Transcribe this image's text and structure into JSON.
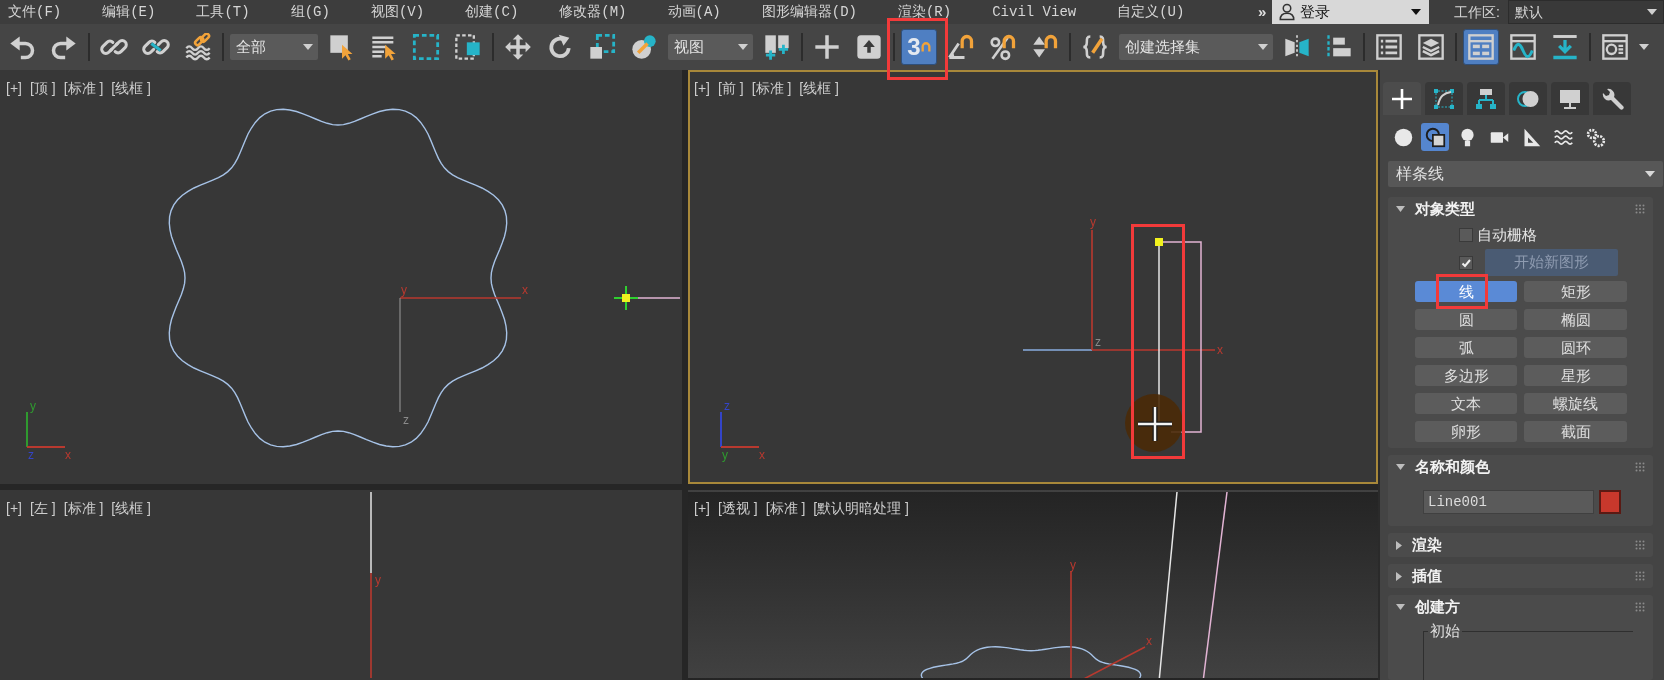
{
  "menu_bar": {
    "items": [
      "文件(F)",
      "编辑(E)",
      "工具(T)",
      "组(G)",
      "视图(V)",
      "创建(C)",
      "修改器(M)",
      "动画(A)",
      "图形编辑器(D)",
      "渲染(R)",
      "Civil View",
      "自定义(U)"
    ],
    "overflow": "»",
    "login": "登录",
    "workspace_label": "工作区:",
    "workspace": "默认"
  },
  "toolbar": {
    "selection_filter": "全部",
    "reference_coordinate": "视图",
    "snap_toggle": {
      "label": "3",
      "on": true
    },
    "named_selection_set": "创建选择集",
    "ribbon_toggle": {
      "on": true
    }
  },
  "viewports": [
    {
      "kind": "top",
      "selected": false,
      "labels": [
        "[+]",
        "[顶 ]",
        "[标准 ]",
        "[线框 ]"
      ],
      "axis_labels": [
        "y",
        "x",
        "z"
      ],
      "tripod_labels": [
        "y",
        "z",
        "x"
      ]
    },
    {
      "kind": "front",
      "selected": true,
      "labels": [
        "[+]",
        "[前 ]",
        "[标准 ]",
        "[线框 ]"
      ],
      "axis_labels": [
        "y",
        "z",
        "x"
      ],
      "tripod_labels": [
        "z",
        "y",
        "x"
      ]
    },
    {
      "kind": "left",
      "selected": false,
      "labels": [
        "[+]",
        "[左 ]",
        "[标准 ]",
        "[线框 ]"
      ],
      "axis_labels": [
        "y"
      ]
    },
    {
      "kind": "perspective",
      "selected": false,
      "labels": [
        "[+]",
        "[透视 ]",
        "[标准 ]",
        "[默认明暗处理 ]"
      ],
      "axis_labels": [
        "y",
        "x"
      ]
    }
  ],
  "command_panel": {
    "tabs": [
      {
        "selected": true
      },
      {
        "selected": false
      },
      {
        "selected": false
      },
      {
        "selected": false
      },
      {
        "selected": false
      },
      {
        "selected": false
      }
    ],
    "categories": [
      {
        "selected": false
      },
      {
        "selected": true
      },
      {
        "selected": false
      },
      {
        "selected": false
      },
      {
        "selected": false
      },
      {
        "selected": false
      },
      {
        "selected": false
      }
    ],
    "type_dropdown": "样条线",
    "rollouts": [
      {
        "kind": "types",
        "title": "对象类型",
        "expanded": true,
        "auto_grid": {
          "label": "自动栅格",
          "checked": false
        },
        "start_new_shape": {
          "checked": true,
          "label": "开始新图形",
          "disabled": true
        },
        "buttons": [
          {
            "label": "线",
            "selected": true
          },
          {
            "label": "矩形",
            "selected": false
          },
          {
            "label": "圆",
            "selected": false
          },
          {
            "label": "椭圆",
            "selected": false
          },
          {
            "label": "弧",
            "selected": false
          },
          {
            "label": "圆环",
            "selected": false
          },
          {
            "label": "多边形",
            "selected": false
          },
          {
            "label": "星形",
            "selected": false
          },
          {
            "label": "文本",
            "selected": false
          },
          {
            "label": "螺旋线",
            "selected": false
          },
          {
            "label": "卵形",
            "selected": false
          },
          {
            "label": "截面",
            "selected": false
          }
        ]
      },
      {
        "kind": "naming",
        "title": "名称和颜色",
        "expanded": true,
        "name": "Line001",
        "color": "#c8382c"
      },
      {
        "title": "渲染",
        "expanded": false
      },
      {
        "title": "插值",
        "expanded": false
      },
      {
        "kind": "method",
        "title": "创建方",
        "expanded": true,
        "group_label": "初始"
      }
    ]
  }
}
